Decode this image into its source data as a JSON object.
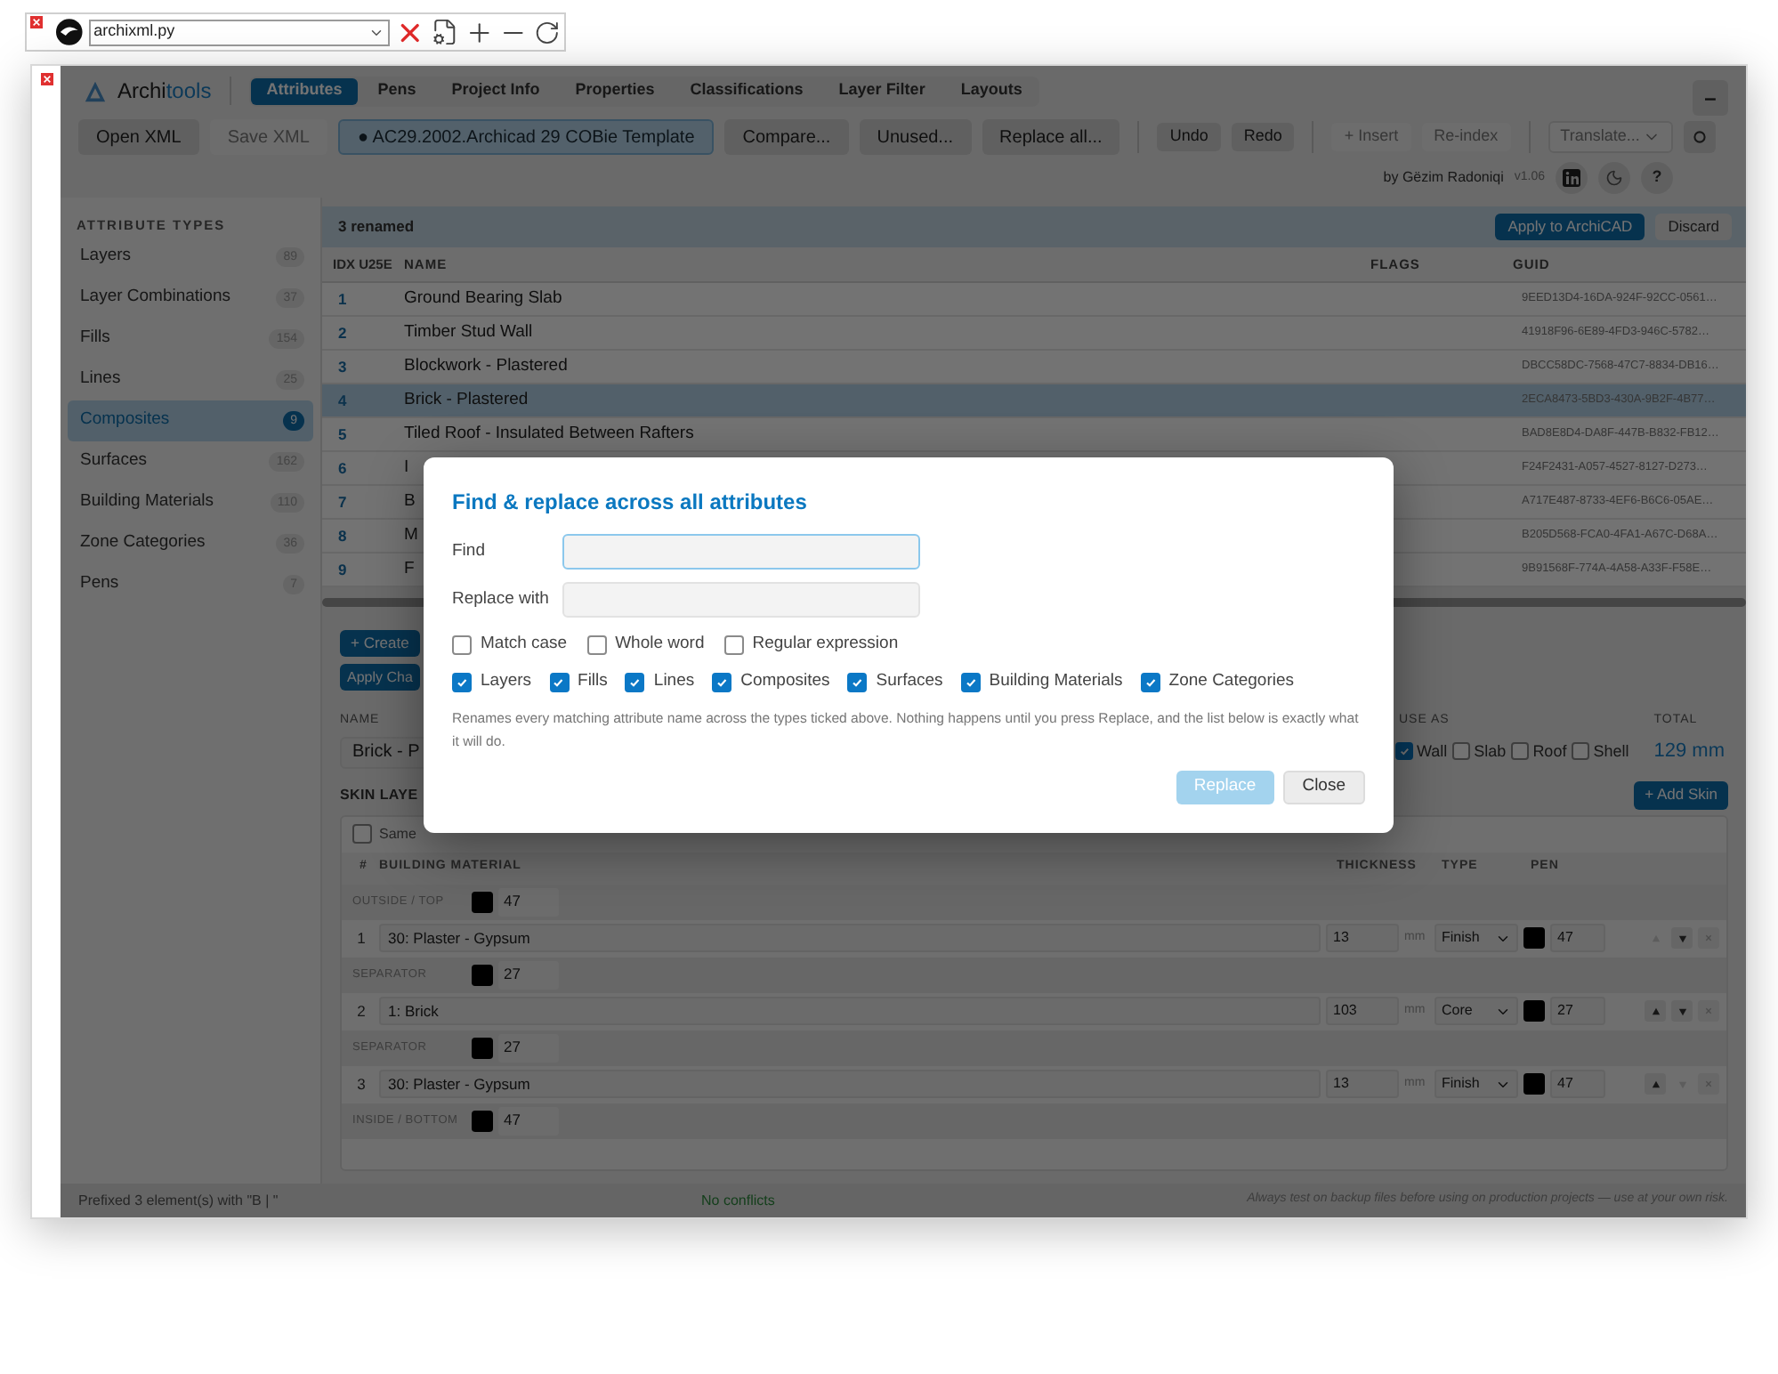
{
  "host_bar": {
    "file": "archixml.py"
  },
  "app": {
    "brand": {
      "prefix": "Archi",
      "suffix": "tools"
    },
    "tabs": [
      {
        "label": "Attributes",
        "selected": true
      },
      {
        "label": "Pens",
        "selected": false
      },
      {
        "label": "Project Info",
        "selected": false
      },
      {
        "label": "Properties",
        "selected": false
      },
      {
        "label": "Classifications",
        "selected": false
      },
      {
        "label": "Layer Filter",
        "selected": false
      },
      {
        "label": "Layouts",
        "selected": false
      }
    ],
    "minimize": "–",
    "toolbar": [
      {
        "kind": "button",
        "label": "Open XML",
        "disabled": false
      },
      {
        "kind": "button",
        "label": "Save XML",
        "disabled": true
      },
      {
        "kind": "file",
        "label": "● AC29.2002.Archicad 29 COBie Template",
        "disabled": false
      },
      {
        "kind": "button",
        "label": "Compare...",
        "disabled": false
      },
      {
        "kind": "button",
        "label": "Unused...",
        "disabled": false
      },
      {
        "kind": "button",
        "label": "Replace all...",
        "disabled": false
      },
      {
        "kind": "divider"
      },
      {
        "kind": "small",
        "label": "Undo",
        "disabled": false
      },
      {
        "kind": "small",
        "label": "Redo",
        "disabled": false
      },
      {
        "kind": "divider"
      },
      {
        "kind": "small",
        "label": "+ Insert",
        "disabled": true
      },
      {
        "kind": "small",
        "label": "Re-index",
        "disabled": true
      },
      {
        "kind": "divider"
      },
      {
        "kind": "select",
        "label": "Translate...",
        "disabled": true
      },
      {
        "kind": "icon",
        "disabled": false
      }
    ],
    "credit": "by Gëzim Radoniqi",
    "version": "v1.06",
    "help": "?",
    "sidebar": {
      "heading": "ATTRIBUTE TYPES",
      "items": [
        {
          "label": "Layers",
          "count": "89",
          "selected": false
        },
        {
          "label": "Layer Combinations",
          "count": "37",
          "selected": false
        },
        {
          "label": "Fills",
          "count": "154",
          "selected": false
        },
        {
          "label": "Lines",
          "count": "25",
          "selected": false
        },
        {
          "label": "Composites",
          "count": "9",
          "selected": true
        },
        {
          "label": "Surfaces",
          "count": "162",
          "selected": false
        },
        {
          "label": "Building Materials",
          "count": "110",
          "selected": false
        },
        {
          "label": "Zone Categories",
          "count": "36",
          "selected": false
        },
        {
          "label": "Pens",
          "count": "7",
          "selected": false
        }
      ]
    },
    "table": {
      "status": "3 renamed",
      "apply": "Apply to ArchiCAD",
      "discard": "Discard",
      "columns": [
        "IDX U25E",
        "NAME",
        "FLAGS",
        "GUID"
      ],
      "rows": [
        {
          "idx": "1",
          "name": "Ground Bearing Slab",
          "guid": "9EED13D4-16DA-924F-92CC-0561…",
          "selected": false
        },
        {
          "idx": "2",
          "name": "Timber Stud Wall",
          "guid": "41918F96-6E89-4FD3-946C-5782…",
          "selected": false
        },
        {
          "idx": "3",
          "name": "Blockwork - Plastered",
          "guid": "DBCC58DC-7568-47C7-8834-DB16…",
          "selected": false
        },
        {
          "idx": "4",
          "name": "Brick - Plastered",
          "guid": "2ECA8473-5BD3-430A-9B2F-4B77…",
          "selected": true
        },
        {
          "idx": "5",
          "name": "Tiled Roof - Insulated Between Rafters",
          "guid": "BAD8E8D4-DA8F-447B-B832-FB12…",
          "selected": false
        },
        {
          "idx": "6",
          "name": "I",
          "guid": "F24F2431-A057-4527-8127-D273…",
          "selected": false
        },
        {
          "idx": "7",
          "name": "B",
          "guid": "A717E487-8733-4EF6-B6C6-05AE…",
          "selected": false
        },
        {
          "idx": "8",
          "name": "M",
          "guid": "B205D568-FCA0-4FA1-A67C-D68A…",
          "selected": false
        },
        {
          "idx": "9",
          "name": "F",
          "guid": "9B91568F-774A-4A58-A33F-F58E…",
          "selected": false
        }
      ]
    },
    "editor": {
      "create": "+ Create",
      "apply": "Apply Cha",
      "name_label": "NAME",
      "name_value": "Brick - P",
      "use_as_label": "USE AS",
      "use_as": [
        {
          "label": "Wall",
          "checked": true
        },
        {
          "label": "Slab",
          "checked": false
        },
        {
          "label": "Roof",
          "checked": false
        },
        {
          "label": "Shell",
          "checked": false
        }
      ],
      "total_label": "TOTAL",
      "total": "129 mm",
      "skins_heading": "SKIN LAYE",
      "add_skin": "+ Add Skin",
      "same": {
        "label": "Same",
        "checked": false
      },
      "columns": [
        "#",
        "BUILDING MATERIAL",
        "THICKNESS",
        "TYPE",
        "PEN"
      ],
      "skins": [
        {
          "kind": "separator",
          "label": "OUTSIDE / TOP",
          "color": "#000000",
          "pen": "47"
        },
        {
          "kind": "skin",
          "num": "1",
          "material": "30: Plaster - Gypsum",
          "thickness": "13",
          "unit": "mm",
          "type": "Finish",
          "color": "#000000",
          "pen": "47",
          "up_disabled": true,
          "down_disabled": false
        },
        {
          "kind": "separator",
          "label": "SEPARATOR",
          "color": "#000000",
          "pen": "27"
        },
        {
          "kind": "skin",
          "num": "2",
          "material": "1: Brick",
          "thickness": "103",
          "unit": "mm",
          "type": "Core",
          "color": "#000000",
          "pen": "27",
          "up_disabled": false,
          "down_disabled": false
        },
        {
          "kind": "separator",
          "label": "SEPARATOR",
          "color": "#000000",
          "pen": "27"
        },
        {
          "kind": "skin",
          "num": "3",
          "material": "30: Plaster - Gypsum",
          "thickness": "13",
          "unit": "mm",
          "type": "Finish",
          "color": "#000000",
          "pen": "47",
          "up_disabled": false,
          "down_disabled": true
        },
        {
          "kind": "separator",
          "label": "INSIDE / BOTTOM",
          "color": "#000000",
          "pen": "47"
        }
      ]
    },
    "status_bar": {
      "left": "Prefixed 3 element(s) with \"B | \"",
      "center": "No conflicts",
      "right": "Always test on backup files before using on production projects — use at your own risk."
    }
  },
  "dialog": {
    "title": "Find & replace across all attributes",
    "find_label": "Find",
    "replace_label": "Replace with",
    "options": [
      {
        "label": "Match case",
        "checked": false
      },
      {
        "label": "Whole word",
        "checked": false
      },
      {
        "label": "Regular expression",
        "checked": false
      }
    ],
    "types": [
      {
        "label": "Layers",
        "checked": true
      },
      {
        "label": "Fills",
        "checked": true
      },
      {
        "label": "Lines",
        "checked": true
      },
      {
        "label": "Composites",
        "checked": true
      },
      {
        "label": "Surfaces",
        "checked": true
      },
      {
        "label": "Building Materials",
        "checked": true
      },
      {
        "label": "Zone Categories",
        "checked": true
      }
    ],
    "hint": "Renames every matching attribute name across the types ticked above. Nothing happens until you press Replace, and the list below is exactly what it will do.",
    "replace": {
      "label": "Replace",
      "disabled": true
    },
    "close": "Close"
  }
}
